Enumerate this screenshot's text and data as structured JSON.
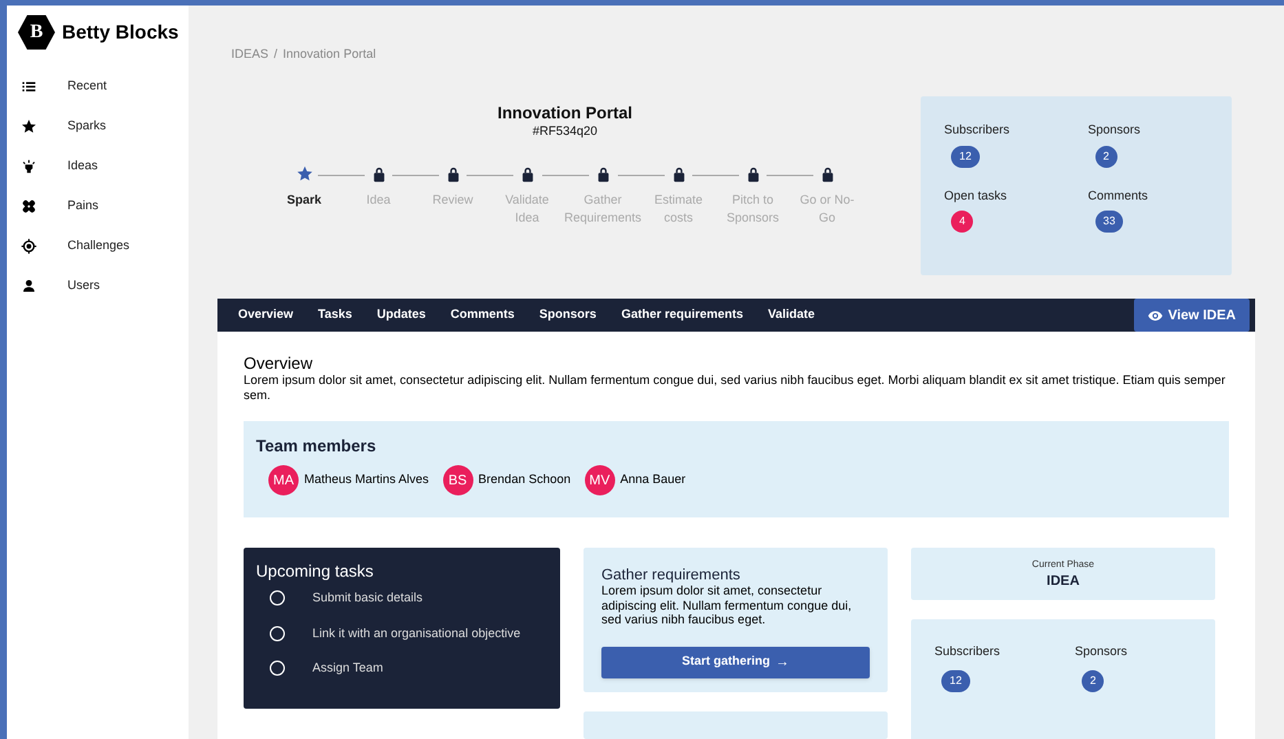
{
  "app": {
    "logo_letter": "B",
    "name": "Betty Blocks"
  },
  "sidebar": {
    "items": [
      {
        "label": "Recent",
        "kind": "list"
      },
      {
        "label": "Sparks",
        "kind": "star"
      },
      {
        "label": "Ideas",
        "kind": "bulb"
      },
      {
        "label": "Pains",
        "kind": "bandage"
      },
      {
        "label": "Challenges",
        "kind": "target"
      },
      {
        "label": "Users",
        "kind": "user"
      }
    ]
  },
  "breadcrumb": [
    "IDEAS",
    "/",
    "Innovation Portal"
  ],
  "header": {
    "title": "Innovation Portal",
    "code": "#RF534q20"
  },
  "stepper": [
    {
      "label": "Spark",
      "selected": true
    },
    {
      "label": "Idea",
      "selected": false
    },
    {
      "label": "Review",
      "selected": false
    },
    {
      "label": "Validate Idea",
      "selected": false
    },
    {
      "label": "Gather Requirements",
      "selected": false
    },
    {
      "label": "Estimate costs",
      "selected": false
    },
    {
      "label": "Pitch to Sponsors",
      "selected": false
    },
    {
      "label": "Go or No-Go",
      "selected": false
    }
  ],
  "stats": [
    {
      "label": "Subscribers",
      "value": "12",
      "color": "#3b5fae"
    },
    {
      "label": "Sponsors",
      "value": "2",
      "color": "#3b5fae"
    },
    {
      "label": "Open tasks",
      "value": "4",
      "color": "#ea1f5c"
    },
    {
      "label": "Comments",
      "value": "33",
      "color": "#3b5fae"
    }
  ],
  "tabs": [
    {
      "label": "Overview"
    },
    {
      "label": "Tasks"
    },
    {
      "label": "Updates"
    },
    {
      "label": "Comments"
    },
    {
      "label": "Sponsors"
    },
    {
      "label": "Gather requirements"
    },
    {
      "label": "Validate"
    }
  ],
  "view_button": "View IDEA",
  "overview": {
    "title": "Overview",
    "text": "Lorem ipsum dolor sit amet, consectetur adipiscing elit. Nullam fermentum congue dui, sed varius nibh faucibus eget. Morbi aliquam blandit ex sit amet tristique. Etiam quis semper sem."
  },
  "team": {
    "title": "Team members",
    "members": [
      {
        "initials": "MA",
        "name": "Matheus Martins Alves"
      },
      {
        "initials": "BS",
        "name": "Brendan Schoon"
      },
      {
        "initials": "MV",
        "name": "Anna Bauer"
      }
    ]
  },
  "upcoming_tasks": {
    "title": "Upcoming tasks",
    "items": [
      {
        "label": "Submit basic details",
        "checked": false
      },
      {
        "label": "Link it with an organisational objective",
        "checked": false
      },
      {
        "label": "Assign Team",
        "checked": false
      }
    ]
  },
  "gather": {
    "title": "Gather requirements",
    "text": "Lorem ipsum dolor sit amet, consectetur adipiscing elit. Nullam fermentum congue dui, sed varius nibh faucibus eget.",
    "button": "Start gathering",
    "button_icon": "→"
  },
  "phase": {
    "label": "Current Phase",
    "value": "IDEA"
  },
  "stats_small": [
    {
      "label": "Subscribers",
      "value": "12"
    },
    {
      "label": "Sponsors",
      "value": "2"
    }
  ]
}
